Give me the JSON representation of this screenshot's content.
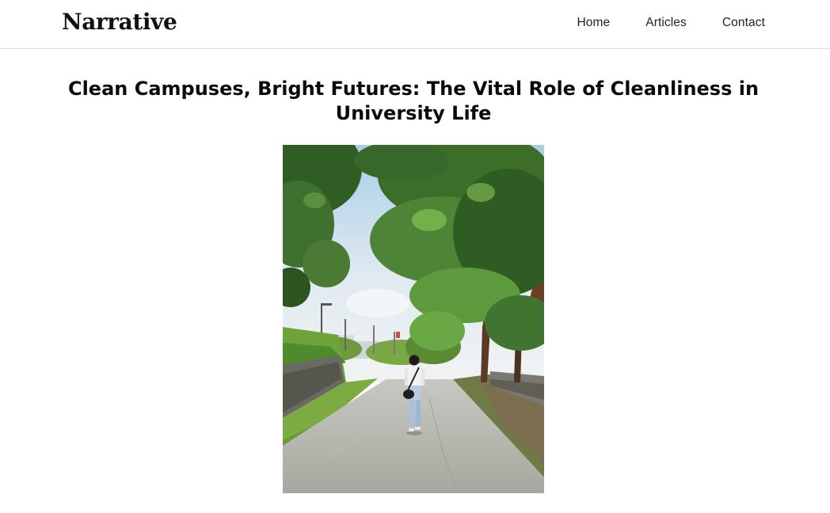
{
  "site": {
    "brand": "Narrative"
  },
  "nav": {
    "items": [
      {
        "label": "Home"
      },
      {
        "label": "Articles"
      },
      {
        "label": "Contact"
      }
    ]
  },
  "article": {
    "title": "Clean Campuses, Bright Futures: The Vital Role of Cleanliness in University Life",
    "hero_image": {
      "subject": "person walking up a tree-lined campus road"
    }
  },
  "colors": {
    "text": "#111111",
    "divider": "#dcdcdc",
    "background": "#ffffff"
  },
  "icons": {
    "hero": "landscape-photo"
  }
}
